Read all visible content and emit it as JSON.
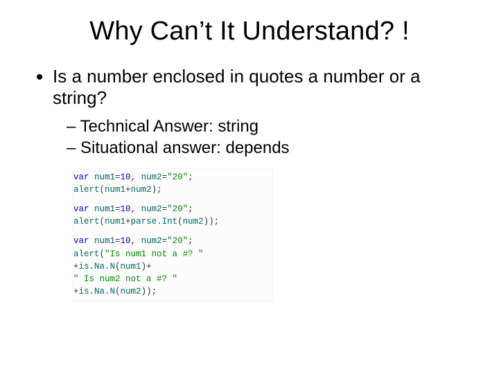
{
  "title": "Why Can’t It Understand? !",
  "bullet1": "Is a number enclosed in quotes a number or a string?",
  "sub1": "– Technical Answer: string",
  "sub2": "– Situational answer: depends",
  "code": {
    "b1l1": {
      "kw": "var ",
      "id1": "num1",
      "eq1": "=",
      "n1": "10",
      "c1": ", ",
      "id2": "num2",
      "eq2": "=",
      "s1": "\"20\"",
      "semi": ";"
    },
    "b1l2": {
      "fn": "alert",
      "op": "(",
      "a1": "num1",
      "plus": "+",
      "a2": "num2",
      "cl": ");"
    },
    "b2l1": {
      "kw": "var ",
      "id1": "num1",
      "eq1": "=",
      "n1": "10",
      "c1": ", ",
      "id2": "num2",
      "eq2": "=",
      "s1": "\"20\"",
      "semi": ";"
    },
    "b2l2": {
      "fn": "alert",
      "op": "(",
      "a1": "num1",
      "plus": "+",
      "p1": "parse.Int",
      "op2": "(",
      "a2": "num2",
      "cl": "));"
    },
    "b3l1": {
      "kw": "var ",
      "id1": "num1",
      "eq1": "=",
      "n1": "10",
      "c1": ", ",
      "id2": "num2",
      "eq2": "=",
      "s1": "\"20\"",
      "semi": ";"
    },
    "b3l2": {
      "fn": "alert",
      "op": "(",
      "s": "\"Is num1 not a #? \""
    },
    "b3l3": {
      "plus": "+",
      "fn": "is.Na.N",
      "op": "(",
      "a": "num1",
      "cl": ")+"
    },
    "b3l4": {
      "s": "\" Is num2 not a #? \""
    },
    "b3l5": {
      "plus": "+",
      "fn": "is.Na.N",
      "op": "(",
      "a": "num2",
      "cl": "));"
    }
  }
}
